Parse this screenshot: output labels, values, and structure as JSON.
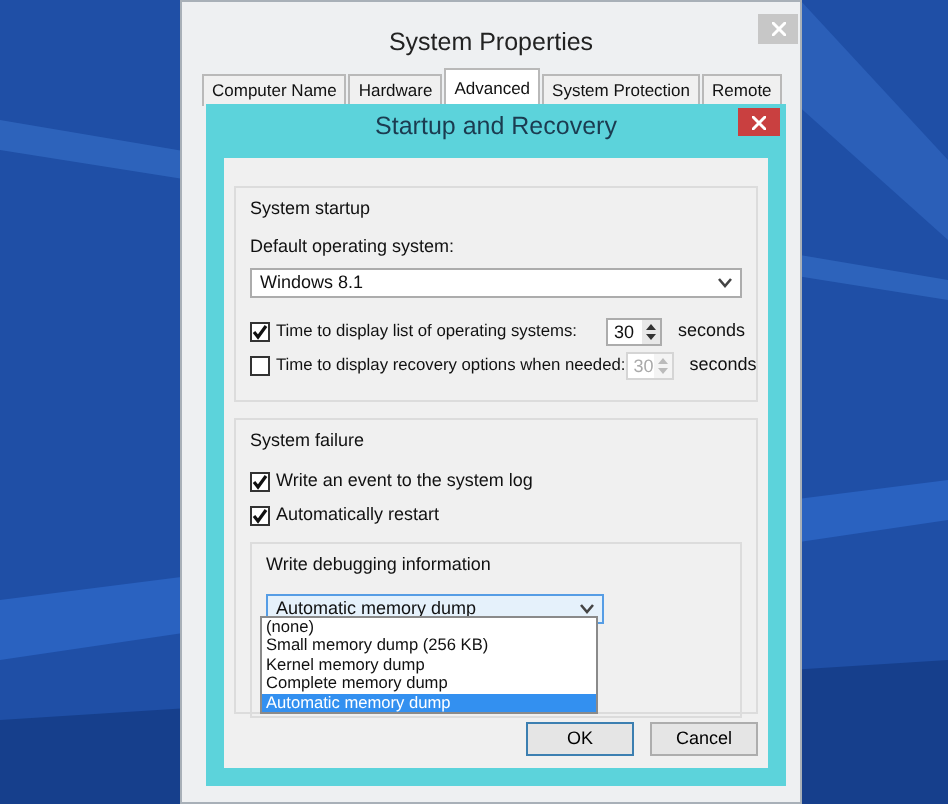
{
  "background_window": {
    "title": "System Properties",
    "tabs": [
      {
        "label": "Computer Name",
        "selected": false
      },
      {
        "label": "Hardware",
        "selected": false
      },
      {
        "label": "Advanced",
        "selected": true
      },
      {
        "label": "System Protection",
        "selected": false
      },
      {
        "label": "Remote",
        "selected": false
      }
    ]
  },
  "dialog": {
    "title": "Startup and Recovery",
    "system_startup": {
      "heading": "System startup",
      "default_os_label": "Default operating system:",
      "default_os": "Windows 8.1",
      "timers": [
        {
          "label": "Time to display list of operating systems:",
          "checked": true,
          "value": "30",
          "unit": "seconds",
          "disabled": false
        },
        {
          "label": "Time to display recovery options when needed:",
          "checked": false,
          "value": "30",
          "unit": "seconds",
          "disabled": true
        }
      ]
    },
    "system_failure": {
      "heading": "System failure",
      "options": [
        {
          "label": "Write an event to the system log",
          "checked": true
        },
        {
          "label": "Automatically restart",
          "checked": true
        }
      ],
      "debug": {
        "heading": "Write debugging information",
        "value": "Automatic memory dump",
        "expanded": true,
        "options": [
          {
            "label": "(none)",
            "selected": false
          },
          {
            "label": "Small memory dump (256 KB)",
            "selected": false
          },
          {
            "label": "Kernel memory dump",
            "selected": false
          },
          {
            "label": "Complete memory dump",
            "selected": false
          },
          {
            "label": "Automatic memory dump",
            "selected": true
          }
        ]
      }
    },
    "buttons": [
      {
        "label": "OK",
        "default": true
      },
      {
        "label": "Cancel",
        "default": false
      }
    ]
  }
}
